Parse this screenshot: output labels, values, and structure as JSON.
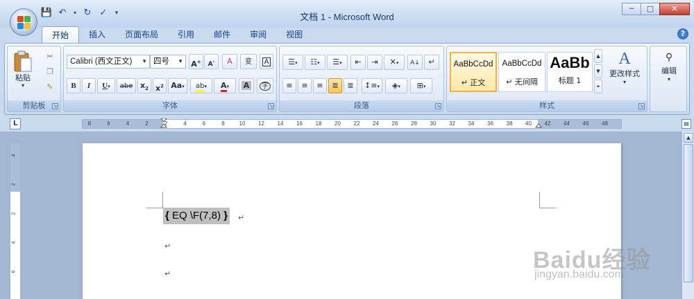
{
  "window": {
    "title": "文档 1 - Microsoft Word",
    "minimize": "─",
    "maximize": "□",
    "close": "✕"
  },
  "quick_access": [
    "save-icon",
    "undo-icon",
    "redo-icon",
    "spellcheck-icon",
    "customize-icon"
  ],
  "tabs": [
    {
      "label": "开始",
      "active": true
    },
    {
      "label": "插入"
    },
    {
      "label": "页面布局"
    },
    {
      "label": "引用"
    },
    {
      "label": "邮件"
    },
    {
      "label": "审阅"
    },
    {
      "label": "视图"
    }
  ],
  "ribbon": {
    "clipboard": {
      "label": "剪贴板",
      "paste": "粘贴"
    },
    "font": {
      "label": "字体",
      "font_name": "Calibri (西文正文)",
      "font_size": "四号"
    },
    "paragraph": {
      "label": "段落"
    },
    "styles": {
      "label": "样式",
      "items": [
        {
          "sample": "AaBbCcDd",
          "name": "↵ 正文",
          "selected": true
        },
        {
          "sample": "AaBbCcDd",
          "name": "↵ 无间隔"
        },
        {
          "sample": "AaBb",
          "name": "标题 1"
        }
      ],
      "change_styles": "更改样式"
    },
    "editing": {
      "label": "编辑"
    }
  },
  "ruler": {
    "ticks": [
      "8",
      "6",
      "4",
      "2",
      "2",
      "4",
      "6",
      "8",
      "10",
      "12",
      "14",
      "16",
      "18",
      "20",
      "22",
      "24",
      "26",
      "28",
      "30",
      "32",
      "34",
      "36",
      "38",
      "40",
      "42",
      "44",
      "46",
      "48"
    ],
    "vticks": [
      "4",
      "2",
      "2",
      "4",
      "6"
    ]
  },
  "document": {
    "field_open": "{",
    "field_code": " EQ \\F(7,8) ",
    "field_close": "}",
    "paragraph_mark": "↵"
  },
  "watermark": {
    "main": "Baidu经验",
    "sub": "jingyan.baidu.com"
  },
  "colors": {
    "accent": "#15428b",
    "selection": "#c0c0c0",
    "style_selected": "#f2b23b"
  }
}
